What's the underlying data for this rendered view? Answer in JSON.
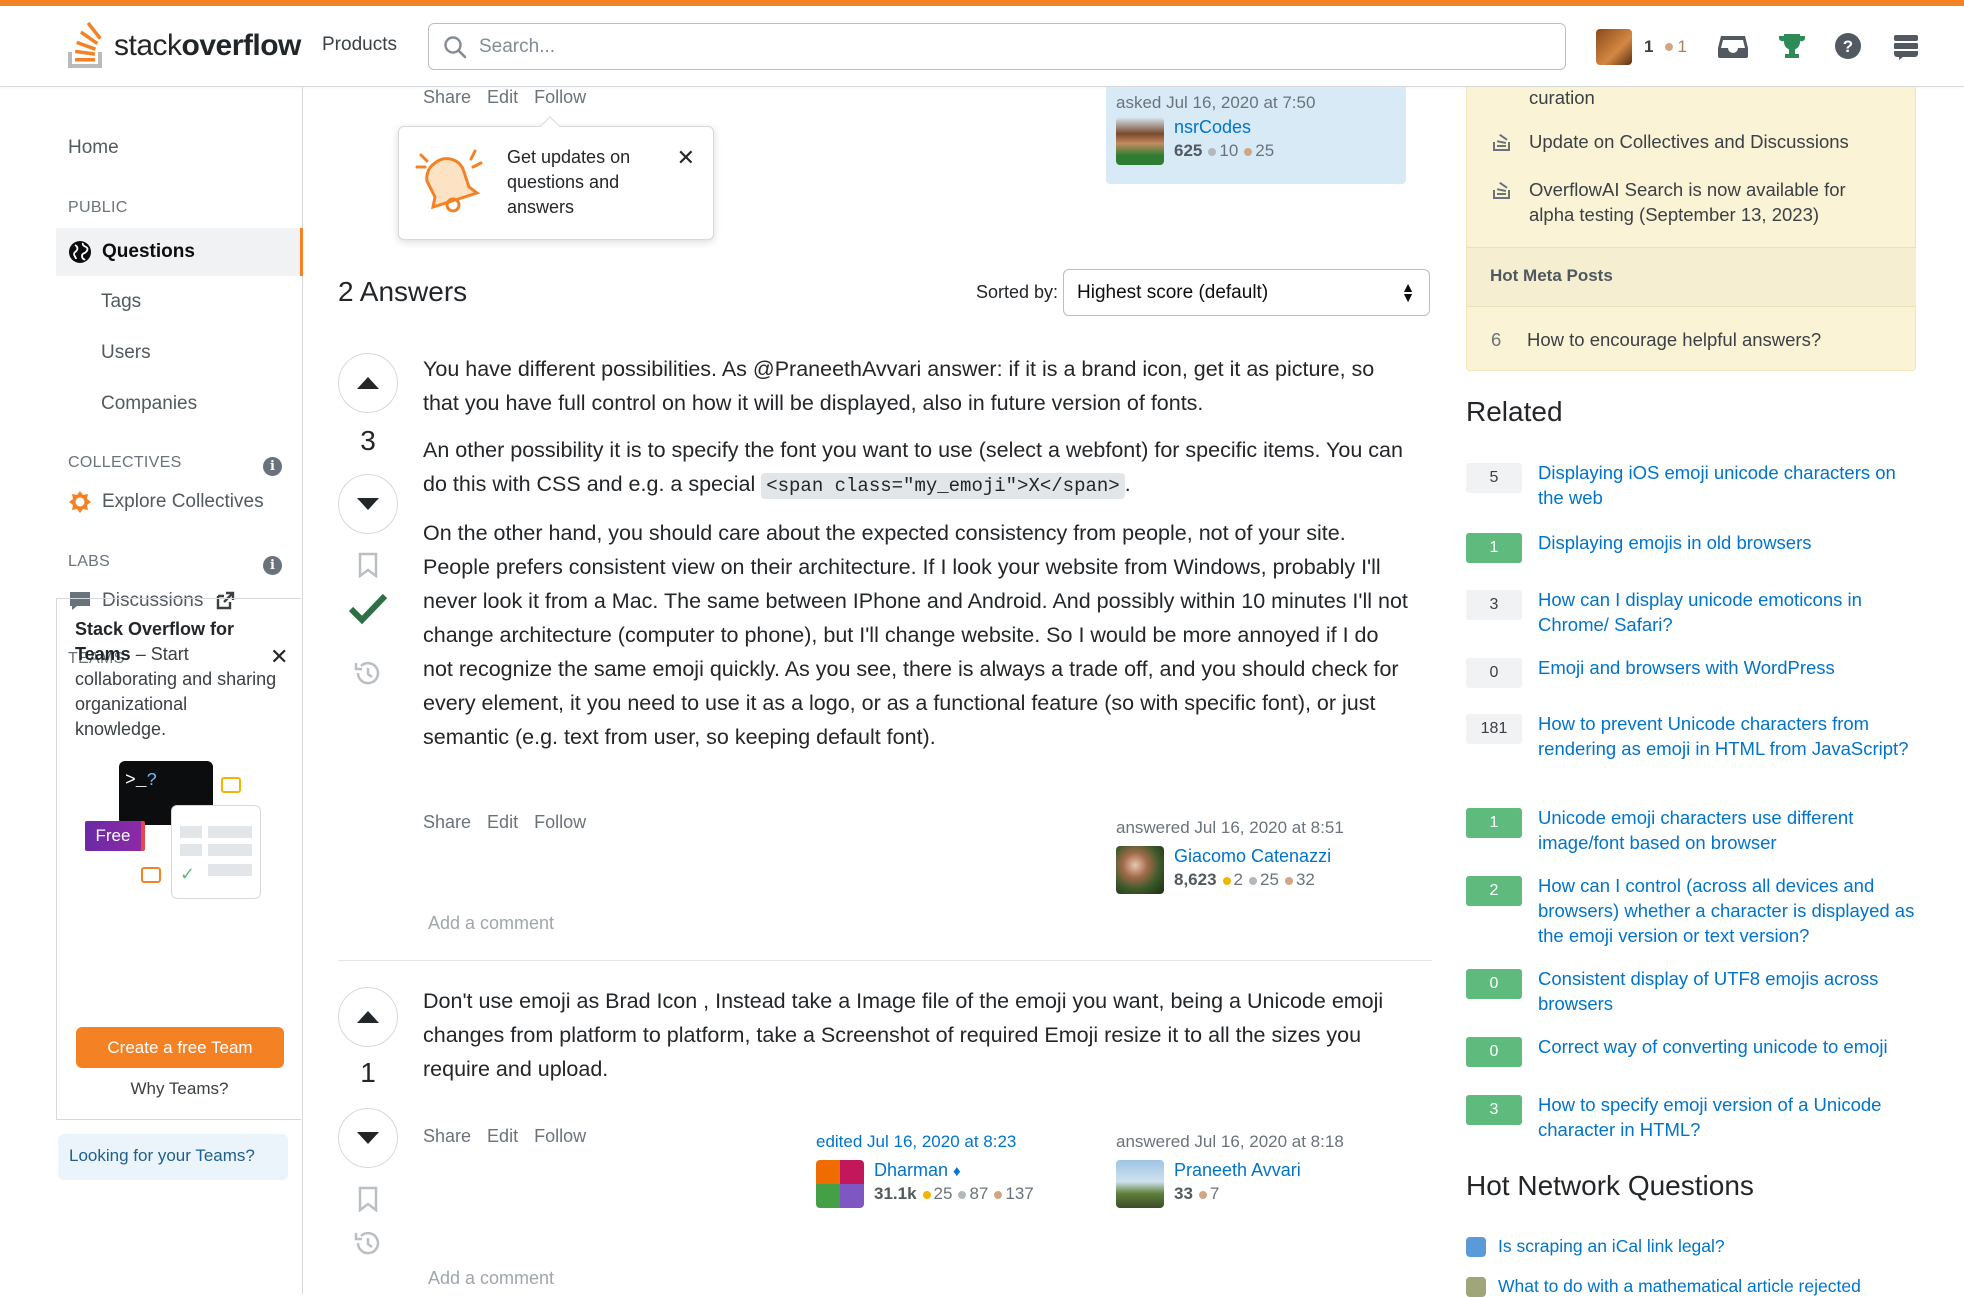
{
  "topbar": {
    "logo_light": "stack",
    "logo_bold": "overflow",
    "products": "Products",
    "search_placeholder": "Search...",
    "reputation": "1",
    "bronze_badges": "1",
    "icons": [
      "inbox-icon",
      "achievements-icon",
      "help-icon",
      "site-switcher-icon"
    ]
  },
  "leftnav": {
    "home": "Home",
    "public": "PUBLIC",
    "questions": "Questions",
    "tags": "Tags",
    "users": "Users",
    "companies": "Companies",
    "collectives": "COLLECTIVES",
    "explore_collectives": "Explore Collectives",
    "labs": "LABS",
    "discussions": "Discussions",
    "teams": "TEAMS",
    "teams_title": "Stack Overflow for Teams",
    "teams_dash": " – Start collaborating and sharing organizational knowledge.",
    "free_badge": "Free",
    "create_team": "Create a free Team",
    "why_teams": "Why Teams?",
    "looking_teams": "Looking for your Teams?"
  },
  "question": {
    "actions": [
      "Share",
      "Edit",
      "Follow"
    ],
    "asked": "asked Jul 16, 2020 at 7:50",
    "asker_name": "nsrCodes",
    "asker_rep": "625",
    "asker_silver": "10",
    "asker_bronze": "25"
  },
  "popover": {
    "text": "Get updates on questions and answers",
    "close": "✕"
  },
  "answers_header": {
    "title": "2 Answers",
    "sorted_by": "Sorted by:",
    "sort_value": "Highest score (default)"
  },
  "answer1": {
    "score": "3",
    "accepted": true,
    "p1": "You have different possibilities. As @PraneethAvvari answer: if it is a brand icon, get it as picture, so that you have full control on how it will be displayed, also in future version of fonts.",
    "p2a": "An other possibility it is to specify the font you want to use (select a webfont) for specific items. You can do this with CSS and e.g. a special ",
    "p2code": "<span class=\"my_emoji\">X</span>",
    "p2b": ".",
    "p3": "On the other hand, you should care about the expected consistency from people, not of your site. People prefers consistent view on their architecture. If I look your website from Windows, probably I'll never look it from a Mac. The same between IPhone and Android. And possibly within 10 minutes I'll not change architecture (computer to phone), but I'll change website. So I would be more annoyed if I do not recognize the same emoji quickly. As you see, there is always a trade off, and you should check for every element, it you need to use it as a logo, or as a functional feature (so with specific font), or just semantic (e.g. text from user, so keeping default font).",
    "actions": [
      "Share",
      "Edit",
      "Follow"
    ],
    "answered": "answered Jul 16, 2020 at 8:51",
    "author": "Giacomo Catenazzi",
    "rep": "8,623",
    "gold": "2",
    "silver": "25",
    "bronze": "32",
    "add_comment": "Add a comment"
  },
  "answer2": {
    "score": "1",
    "p1": "Don't use emoji as Brad Icon , Instead take a Image file of the emoji you want, being a Unicode emoji changes from platform to platform, take a Screenshot of required Emoji resize it to all the sizes you require and upload.",
    "actions": [
      "Share",
      "Edit",
      "Follow"
    ],
    "edited": "edited Jul 16, 2020 at 8:23",
    "editor": "Dharman",
    "editor_mod": "♦",
    "editor_rep": "31.1k",
    "editor_gold": "25",
    "editor_silver": "87",
    "editor_bronze": "137",
    "answered": "answered Jul 16, 2020 at 8:18",
    "author": "Praneeth Avvari",
    "rep": "33",
    "bronze": "7",
    "add_comment": "Add a comment"
  },
  "meta": {
    "item0": "curation",
    "item1": "Update on Collectives and Discussions",
    "item2": "OverflowAI Search is now available for alpha testing (September 13, 2023)",
    "hot_meta": "Hot Meta Posts",
    "hot_count": "6",
    "hot_item": "How to encourage helpful answers?"
  },
  "related": {
    "title": "Related",
    "items": [
      {
        "count": "5",
        "accepted": false,
        "text": "Displaying iOS emoji unicode characters on the web"
      },
      {
        "count": "1",
        "accepted": true,
        "text": "Displaying emojis in old browsers"
      },
      {
        "count": "3",
        "accepted": false,
        "text": "How can I display unicode emoticons in Chrome/ Safari?"
      },
      {
        "count": "0",
        "accepted": false,
        "text": "Emoji and browsers with WordPress"
      },
      {
        "count": "181",
        "accepted": false,
        "text": "How to prevent Unicode characters from rendering as emoji in HTML from JavaScript?"
      },
      {
        "count": "1",
        "accepted": true,
        "text": "Unicode emoji characters use different image/font based on browser"
      },
      {
        "count": "2",
        "accepted": true,
        "text": "How can I control (across all devices and browsers) whether a character is displayed as the emoji version or text version?"
      },
      {
        "count": "0",
        "accepted": true,
        "text": "Consistent display of UTF8 emojis across browsers"
      },
      {
        "count": "0",
        "accepted": true,
        "text": "Correct way of converting unicode to emoji"
      },
      {
        "count": "3",
        "accepted": true,
        "text": "How to specify emoji version of a Unicode character in HTML?"
      }
    ]
  },
  "hnq": {
    "title": "Hot Network Questions",
    "items": [
      "Is scraping an iCal link legal?",
      "What to do with a mathematical article rejected"
    ]
  }
}
